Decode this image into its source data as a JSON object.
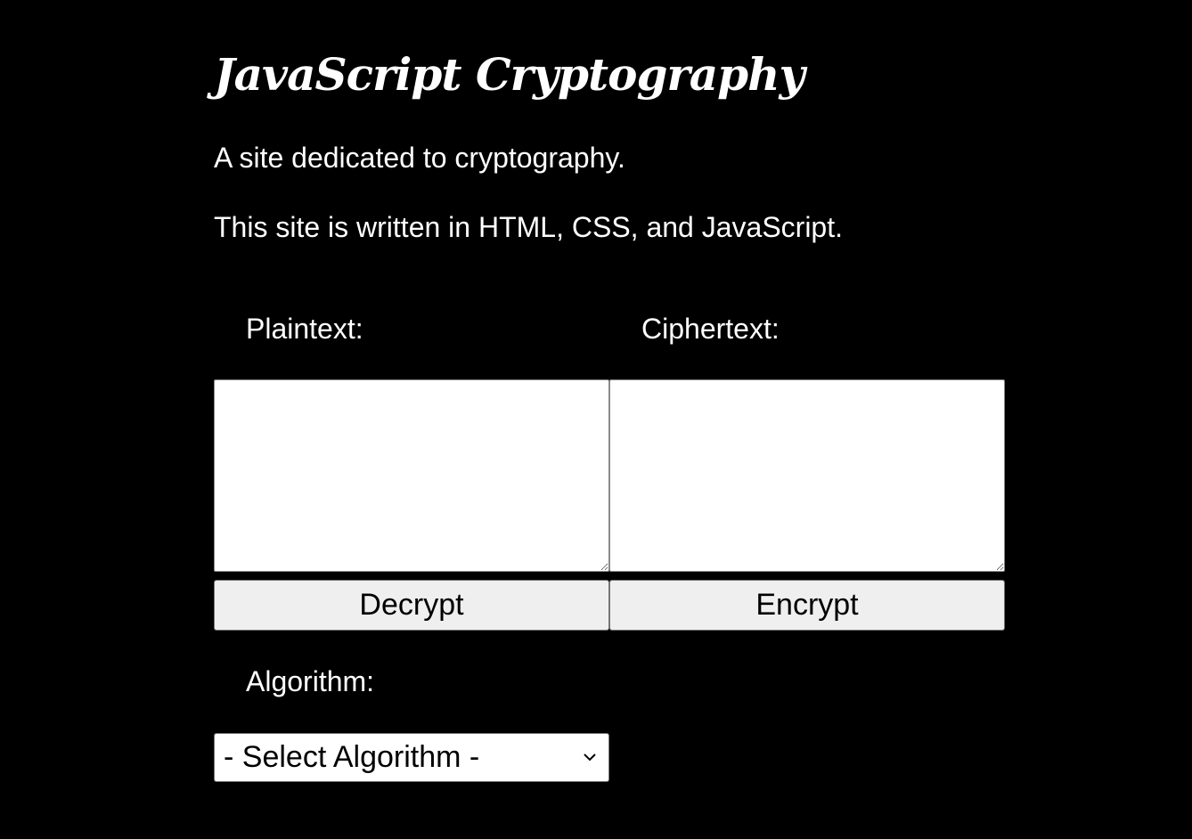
{
  "header": {
    "title": "JavaScript Cryptography",
    "intro": [
      "A site dedicated to cryptography.",
      "This site is written in HTML, CSS, and JavaScript."
    ]
  },
  "form": {
    "plaintext": {
      "label": "Plaintext:",
      "value": ""
    },
    "ciphertext": {
      "label": "Ciphertext:",
      "value": ""
    },
    "buttons": {
      "decrypt": "Decrypt",
      "encrypt": "Encrypt"
    },
    "algorithm": {
      "label": "Algorithm:",
      "selected": "- Select Algorithm -",
      "icon": "chevron-down-icon"
    }
  },
  "colors": {
    "background": "#000000",
    "text": "#ffffff",
    "button": "#efefef"
  }
}
